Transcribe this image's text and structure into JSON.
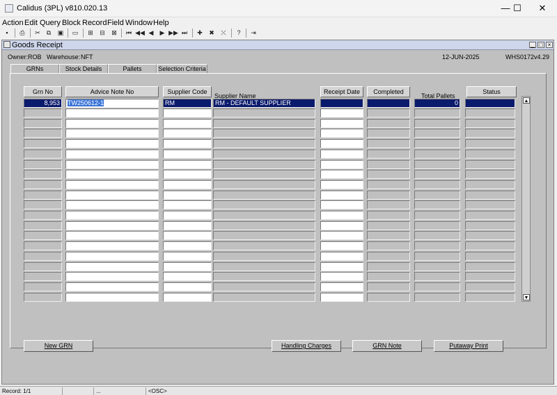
{
  "window": {
    "title": "Calidus (3PL) v810.020.13",
    "minimize": "—",
    "maximize": "☐",
    "close": "✕"
  },
  "menu": [
    "Action",
    "Edit",
    "Query",
    "Block",
    "Record",
    "Field",
    "Window",
    "Help"
  ],
  "toolbar": {
    "icons": [
      "save-icon",
      "print-icon",
      "cut-icon",
      "copy-icon",
      "paste-icon",
      "clear-icon",
      "query-icon",
      "execute-query-icon",
      "cancel-query-icon",
      "first-record-icon",
      "previous-block-icon",
      "previous-record-icon",
      "next-record-icon",
      "next-block-icon",
      "last-record-icon",
      "insert-record-icon",
      "delete-record-icon",
      "duplicate-icon",
      "help-icon",
      "exit-icon"
    ],
    "glyphs": [
      "▪",
      "⎙",
      "✂",
      "⧉",
      "▣",
      "▭",
      "⊞",
      "⊟",
      "⊠",
      "⏮",
      "◀◀",
      "◀",
      "▶",
      "▶▶",
      "⏭",
      "✚",
      "✖",
      "⤫",
      "?",
      "⇥"
    ]
  },
  "form": {
    "title": "Goods Receipt",
    "owner_label": "Owner:",
    "owner": "ROB",
    "warehouse_label": "Warehouse:",
    "warehouse": "NFT",
    "date": "12-JUN-2025",
    "screen_code": "WHS0172",
    "version": "v4.29"
  },
  "tabs": [
    "GRNs",
    "Stock Details",
    "Pallets",
    "Selection Criteria"
  ],
  "table": {
    "columns": {
      "grn_no": "Grn No",
      "advice_note_no": "Advice Note No",
      "supplier_code": "Supplier Code",
      "supplier_name": "Supplier Name",
      "receipt_date": "Receipt Date",
      "completed": "Completed",
      "total_pallets": "Total Pallets",
      "status": "Status"
    },
    "rows": [
      {
        "grn_no": "8,953",
        "advice_note_no": "TW250612-1",
        "supplier_code": "RM",
        "supplier_name": "RM - DEFAULT SUPPLIER",
        "receipt_date": "",
        "completed": "",
        "total_pallets": "0",
        "status": ""
      }
    ],
    "empty_rows": 19
  },
  "buttons": {
    "new_grn": "New GRN",
    "handling_charges": "Handling Charges",
    "grn_note": "GRN Note",
    "putaway_print": "Putaway Print"
  },
  "status_bar": {
    "record": "Record: 1/1",
    "dots": "...",
    "mode": "<OSC>"
  },
  "colors": {
    "selected_row": "#0a1a6c",
    "highlight": "#3a74d8",
    "form_bg": "#c0c0c0"
  }
}
